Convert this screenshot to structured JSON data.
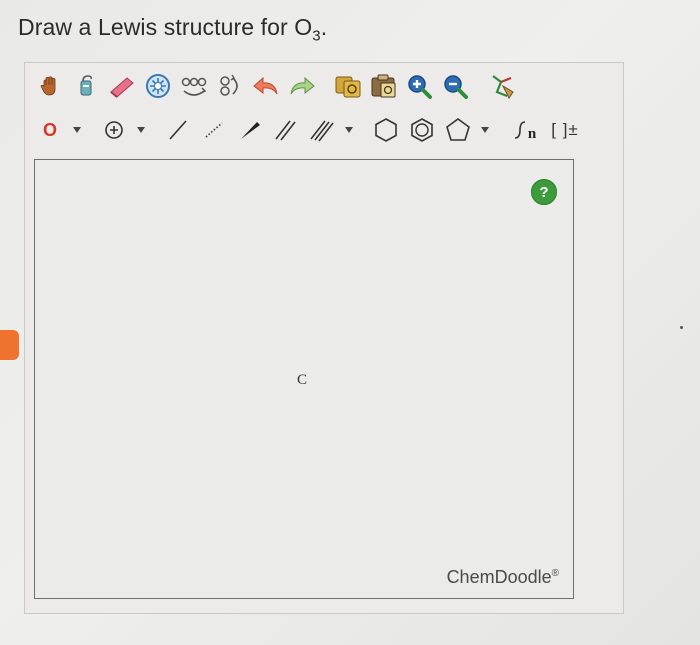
{
  "question": {
    "prefix": "Draw a Lewis structure for O",
    "subscript": "3",
    "suffix": "."
  },
  "toolbar": {
    "atom_label": "O",
    "ring_sizes": [
      "6",
      "6",
      "5"
    ],
    "sgroup_label": "n",
    "charge_label": "[ ]±"
  },
  "canvas": {
    "atom": "C",
    "help_label": "?",
    "brand": "ChemDoodle",
    "brand_mark": "®"
  },
  "colors": {
    "accent_orange": "#f0722f",
    "help_green": "#3c9b3c",
    "atom_red": "#d9362b"
  }
}
